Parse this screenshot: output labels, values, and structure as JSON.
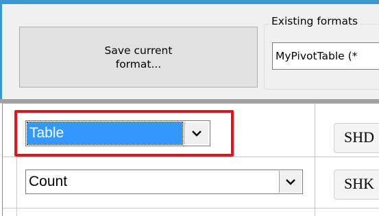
{
  "top_panel": {
    "save_button_label": "Save current\nformat...",
    "existing_formats_label": "Existing formats",
    "existing_formats_value": "MyPivotTable (*"
  },
  "grid": {
    "table_combo": {
      "selected": "Table",
      "icon": "chevron-down-icon"
    },
    "count_combo": {
      "selected": "Count",
      "icon": "chevron-down-icon"
    },
    "side_buttons": [
      "SHD",
      "SHK"
    ]
  },
  "colors": {
    "window_accent": "#3d97cf",
    "selection": "#3399ff",
    "highlight_border": "#e8111b"
  }
}
